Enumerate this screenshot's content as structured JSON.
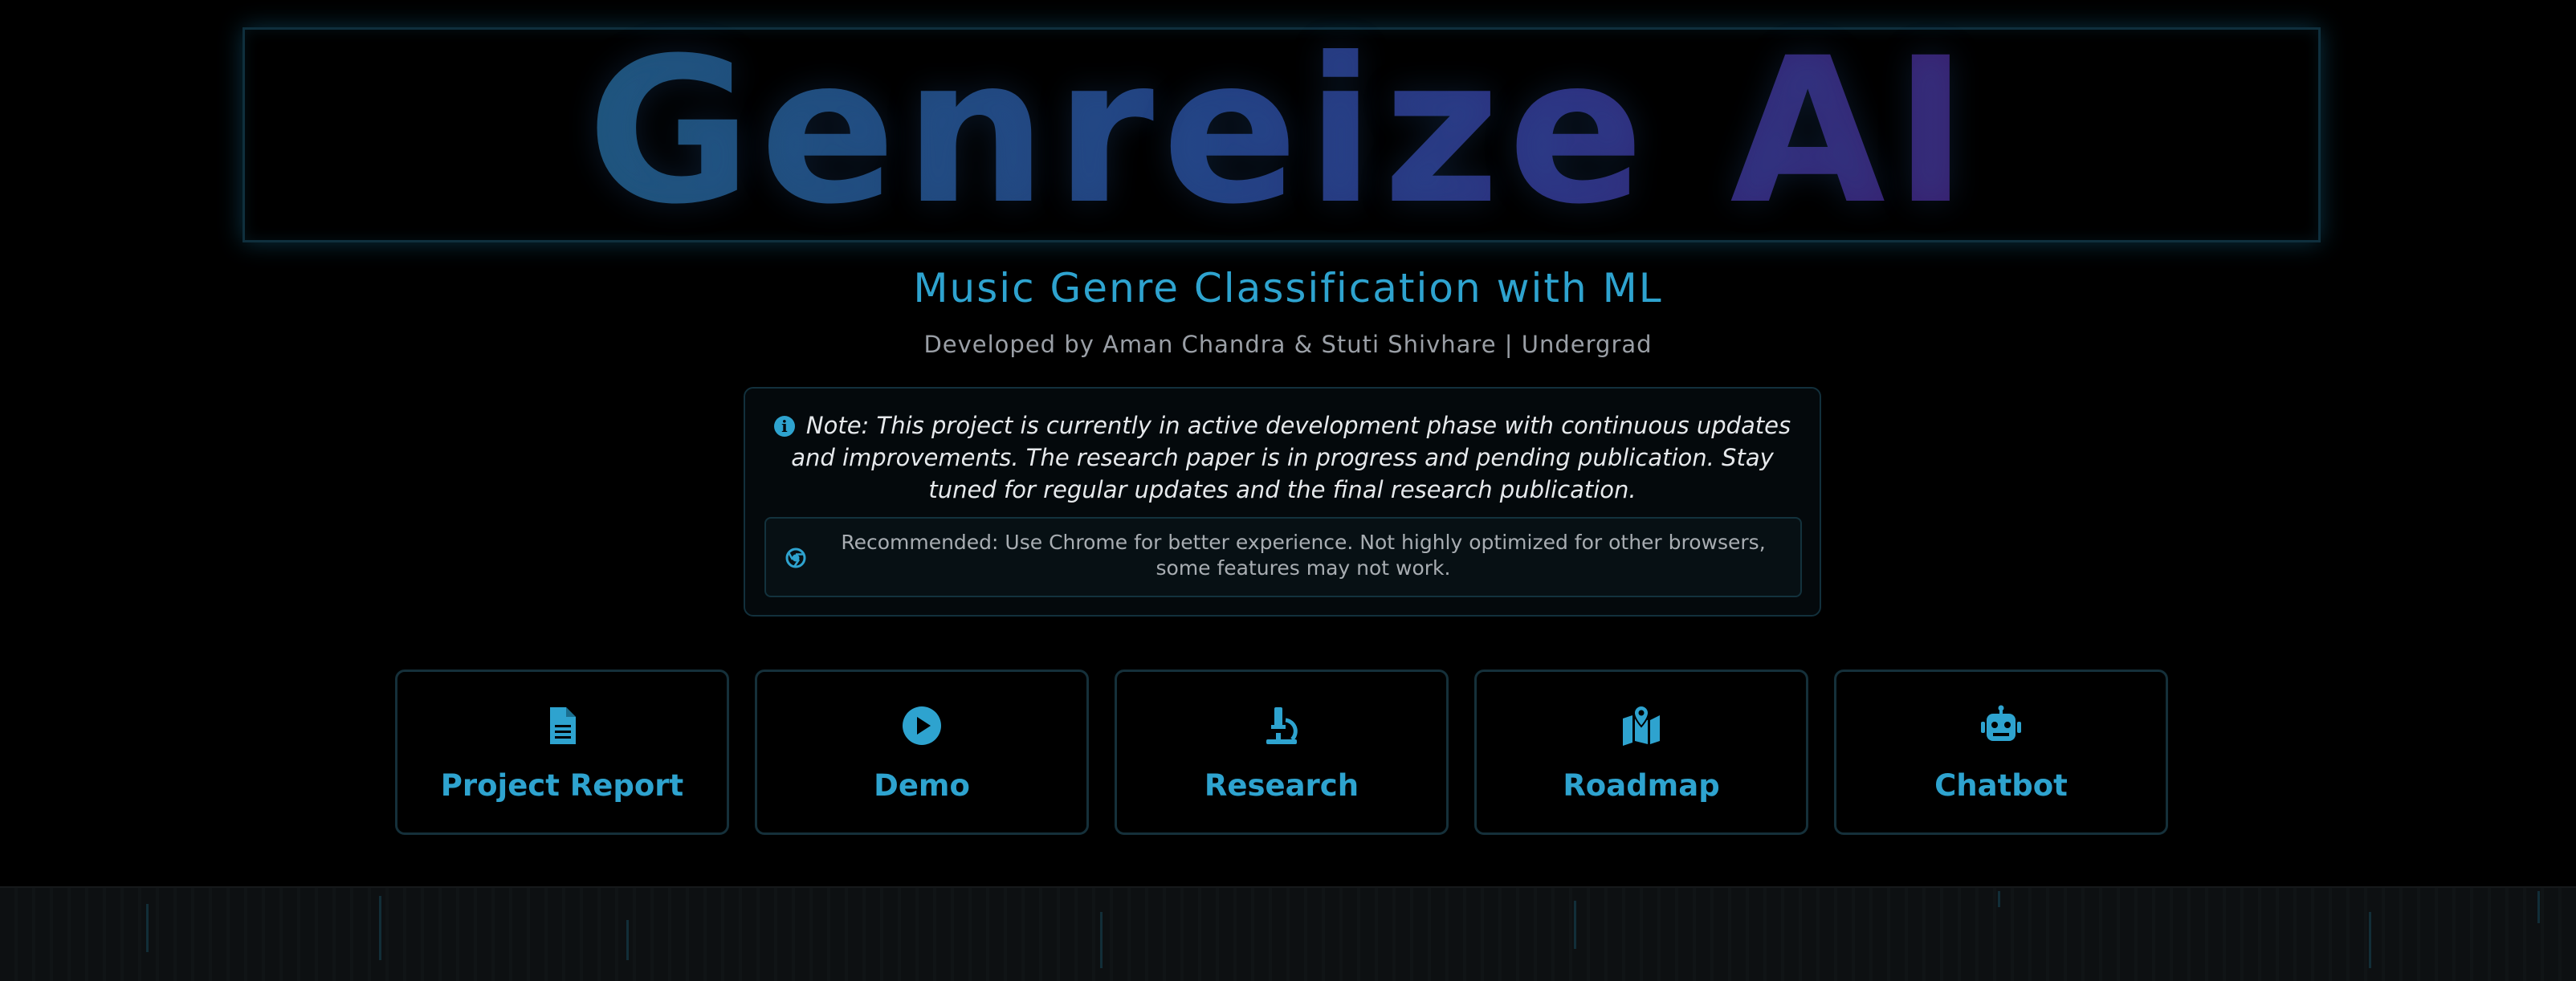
{
  "header": {
    "title": "Genreize AI",
    "subtitle": "Music Genre Classification with ML",
    "credits": "Developed by Aman Chandra & Stuti Shivhare | Undergrad"
  },
  "note": {
    "icon": "info-circle-icon",
    "text": "Note: This project is currently in active development phase with continuous updates and improvements. The research paper is in progress and pending publication. Stay tuned for regular updates and the final research publication.",
    "recommendation": {
      "icon": "chrome-icon",
      "text": "Recommended: Use Chrome for better experience. Not highly optimized for other browsers, some features may not work."
    }
  },
  "nav": {
    "items": [
      {
        "label": "Project Report",
        "icon": "file-document-icon"
      },
      {
        "label": "Demo",
        "icon": "play-circle-icon"
      },
      {
        "label": "Research",
        "icon": "microscope-icon"
      },
      {
        "label": "Roadmap",
        "icon": "map-pin-icon"
      },
      {
        "label": "Chatbot",
        "icon": "robot-icon"
      }
    ]
  },
  "colors": {
    "accent": "#2ea3cf",
    "background": "#000000",
    "title_gradient_start": "#1e5478",
    "title_gradient_end": "#3a1f6e",
    "muted_text": "#9a9fa6",
    "card_border": "#15303a"
  }
}
